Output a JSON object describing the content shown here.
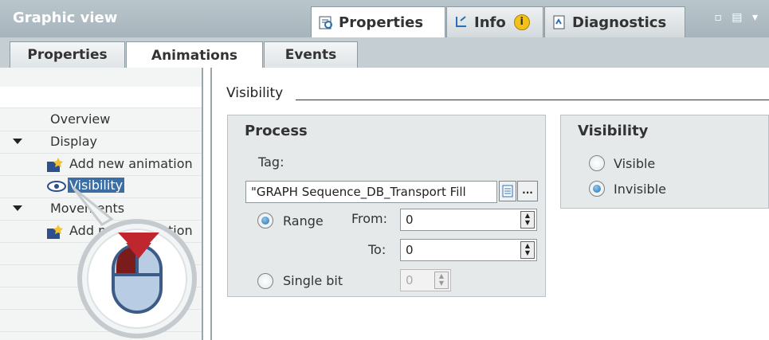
{
  "window": {
    "title": "Graphic view",
    "tabs": [
      {
        "label": "Properties",
        "icon": "properties-icon"
      },
      {
        "label": "Info",
        "icon": "info-icon"
      },
      {
        "label": "Diagnostics",
        "icon": "diagnostics-icon"
      }
    ],
    "window_buttons": "▫ ▤ ▾"
  },
  "subtabs": [
    {
      "label": "Properties"
    },
    {
      "label": "Animations"
    },
    {
      "label": "Events"
    }
  ],
  "tree": {
    "items": [
      {
        "label": "Overview"
      },
      {
        "label": "Display"
      },
      {
        "label": "Add new animation"
      },
      {
        "label": "Visibility"
      },
      {
        "label": "Movements"
      },
      {
        "label": "Add new animation"
      }
    ]
  },
  "section": {
    "title": "Visibility"
  },
  "process": {
    "title": "Process",
    "tag_label": "Tag:",
    "tag_value": "\"GRAPH Sequence_DB_Transport Fill",
    "browse_label": "...",
    "range_label": "Range",
    "from_label": "From:",
    "from_value": "0",
    "to_label": "To:",
    "to_value": "0",
    "single_bit_label": "Single bit",
    "single_bit_value": "0",
    "mode": "range"
  },
  "visibility": {
    "title": "Visibility",
    "visible_label": "Visible",
    "invisible_label": "Invisible",
    "selected": "invisible"
  },
  "colors": {
    "accent": "#1f6fb0",
    "titlebar": "#a7b4bb",
    "selection": "#3a6ea5"
  }
}
